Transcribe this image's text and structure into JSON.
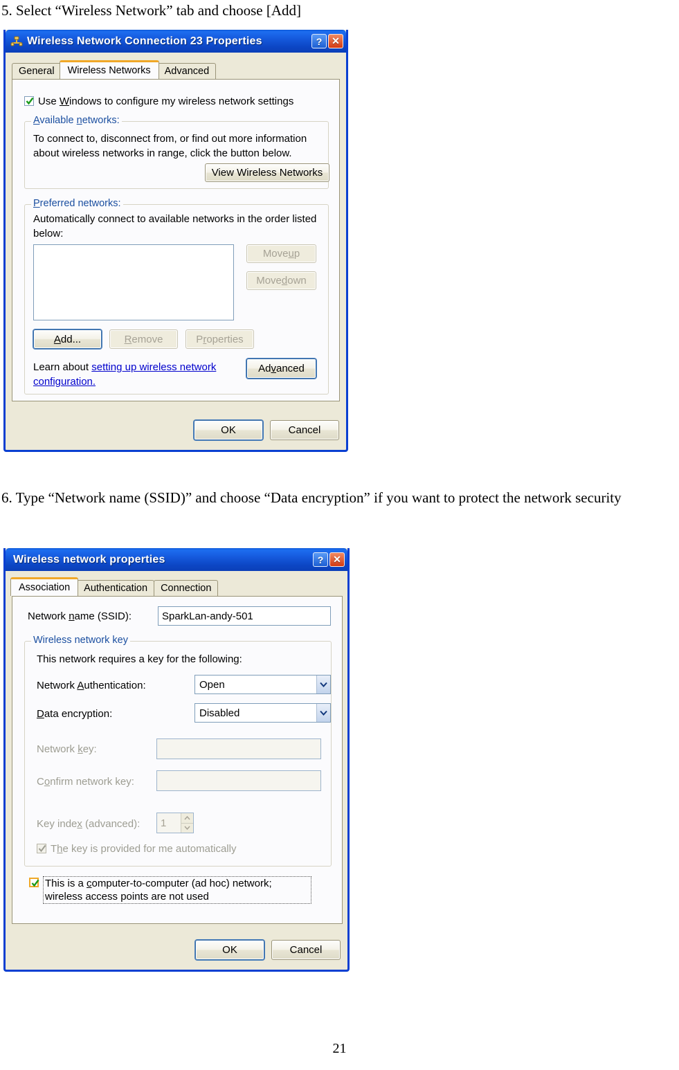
{
  "document": {
    "step5": "5. Select “Wireless Network” tab and choose [Add]",
    "step6": "6. Type “Network name (SSID)” and choose “Data encryption” if you want to protect the network security",
    "page_number": "21"
  },
  "dialog1": {
    "title": "Wireless Network Connection 23 Properties",
    "icon": "network-connection-icon",
    "help_button": "?",
    "close_button": "✕",
    "tabs": [
      {
        "label": "General",
        "active": false
      },
      {
        "label": "Wireless Networks",
        "active": true
      },
      {
        "label": "Advanced",
        "active": false
      }
    ],
    "use_windows_checkbox": {
      "label_before": "Use ",
      "label_accel": "W",
      "label_after": "indows to configure my wireless network settings",
      "checked": true
    },
    "available_networks": {
      "group_title": "Available networks:",
      "description": "To connect to, disconnect from, or find out more information about wireless networks in range, click the button below.",
      "view_button": "View Wireless Networks"
    },
    "preferred_networks": {
      "group_title": "Preferred networks:",
      "description": "Automatically connect to available networks in the order listed below:",
      "list_items": [],
      "move_up_button": "Move up",
      "move_down_button": "Move down",
      "add_button": "Add...",
      "remove_button": "Remove",
      "properties_button": "Properties",
      "learn_prefix": "Learn about ",
      "learn_link": "setting up wireless network configuration.",
      "advanced_button": "Advanced"
    },
    "ok_button": "OK",
    "cancel_button": "Cancel"
  },
  "dialog2": {
    "title": "Wireless network properties",
    "help_button": "?",
    "close_button": "✕",
    "tabs": [
      {
        "label": "Association",
        "active": true
      },
      {
        "label": "Authentication",
        "active": false
      },
      {
        "label": "Connection",
        "active": false
      }
    ],
    "ssid": {
      "label": "Network name (SSID):",
      "value": "SparkLan-andy-501"
    },
    "wireless_key": {
      "group_title": "Wireless network key",
      "description": "This network requires a key for the following:",
      "network_auth_label": "Network Authentication:",
      "network_auth_value": "Open",
      "data_encryption_label": "Data encryption:",
      "data_encryption_value": "Disabled",
      "network_key_label": "Network key:",
      "network_key_value": "",
      "confirm_key_label": "Confirm network key:",
      "confirm_key_value": "",
      "key_index_label": "Key index (advanced):",
      "key_index_value": "1",
      "auto_key_checkbox": "The key is provided for me automatically",
      "auto_key_checked": true
    },
    "adhoc_checkbox": {
      "label": "This is a computer-to-computer (ad hoc) network; wireless access points are not used",
      "checked": true
    },
    "ok_button": "OK",
    "cancel_button": "Cancel"
  },
  "colors": {
    "titlebar_blue": "#1559dc",
    "dialog_face": "#ece9d8",
    "tab_panel": "#fbfbfd",
    "active_tab_accent": "#f0a828",
    "group_label_blue": "#1b4fa0",
    "link_blue": "#0000cc",
    "close_red": "#d43a12"
  }
}
